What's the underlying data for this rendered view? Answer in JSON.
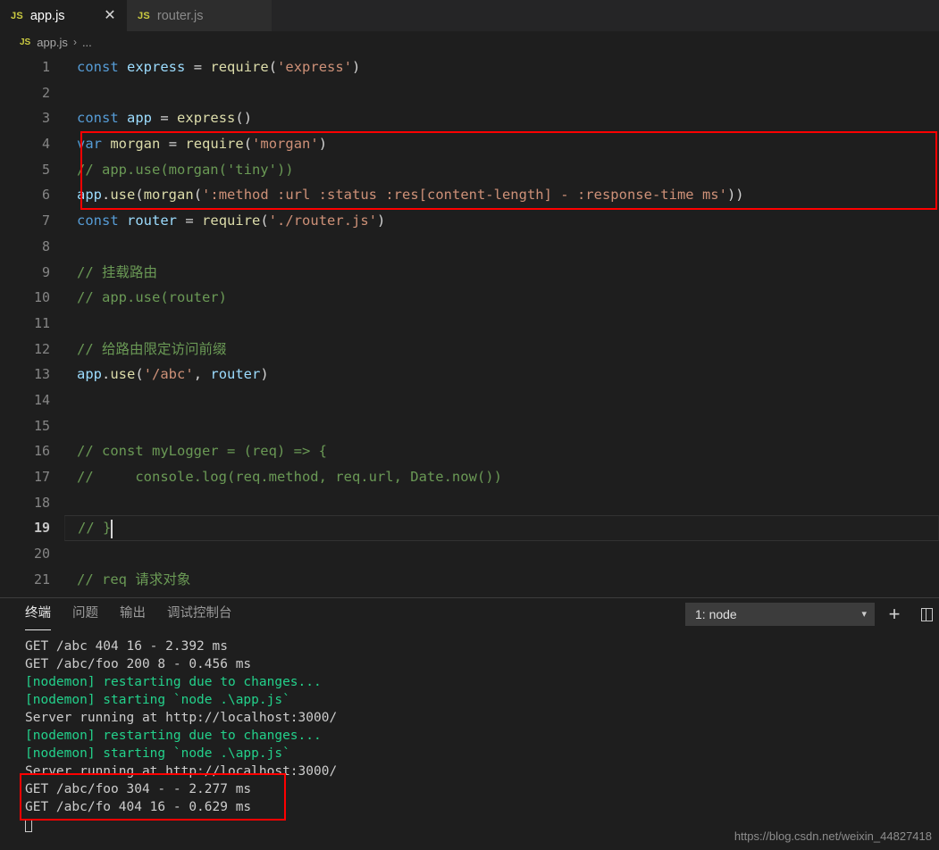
{
  "tabs": [
    {
      "label": "app.js",
      "badge": "JS",
      "active": true,
      "close_icon": "close-icon"
    },
    {
      "label": "router.js",
      "badge": "JS",
      "active": false
    }
  ],
  "breadcrumb": {
    "badge": "JS",
    "file": "app.js",
    "separator": "›",
    "more": "..."
  },
  "editor": {
    "lines": [
      {
        "n": "1",
        "tokens": [
          {
            "t": "const",
            "c": "kw"
          },
          {
            "t": " ",
            "c": "punc"
          },
          {
            "t": "express",
            "c": "ident"
          },
          {
            "t": " ",
            "c": "punc"
          },
          {
            "t": "=",
            "c": "op"
          },
          {
            "t": " ",
            "c": "punc"
          },
          {
            "t": "require",
            "c": "var"
          },
          {
            "t": "(",
            "c": "punc"
          },
          {
            "t": "'express'",
            "c": "str"
          },
          {
            "t": ")",
            "c": "punc"
          }
        ]
      },
      {
        "n": "2",
        "tokens": []
      },
      {
        "n": "3",
        "tokens": [
          {
            "t": "const",
            "c": "kw"
          },
          {
            "t": " ",
            "c": "punc"
          },
          {
            "t": "app",
            "c": "ident"
          },
          {
            "t": " ",
            "c": "punc"
          },
          {
            "t": "=",
            "c": "op"
          },
          {
            "t": " ",
            "c": "punc"
          },
          {
            "t": "express",
            "c": "var"
          },
          {
            "t": "()",
            "c": "punc"
          }
        ]
      },
      {
        "n": "4",
        "tokens": [
          {
            "t": "var",
            "c": "kw"
          },
          {
            "t": " ",
            "c": "punc"
          },
          {
            "t": "morgan",
            "c": "var"
          },
          {
            "t": " ",
            "c": "punc"
          },
          {
            "t": "=",
            "c": "op"
          },
          {
            "t": " ",
            "c": "punc"
          },
          {
            "t": "require",
            "c": "var"
          },
          {
            "t": "(",
            "c": "punc"
          },
          {
            "t": "'morgan'",
            "c": "str"
          },
          {
            "t": ")",
            "c": "punc"
          }
        ]
      },
      {
        "n": "5",
        "tokens": [
          {
            "t": "// app.use(morgan('tiny'))",
            "c": "cmt"
          }
        ]
      },
      {
        "n": "6",
        "tokens": [
          {
            "t": "app",
            "c": "ident"
          },
          {
            "t": ".",
            "c": "punc"
          },
          {
            "t": "use",
            "c": "var"
          },
          {
            "t": "(",
            "c": "punc"
          },
          {
            "t": "morgan",
            "c": "var"
          },
          {
            "t": "(",
            "c": "punc"
          },
          {
            "t": "':method :url :status :res[content-length] - :response-time ms'",
            "c": "str"
          },
          {
            "t": "))",
            "c": "punc"
          }
        ]
      },
      {
        "n": "7",
        "tokens": [
          {
            "t": "const",
            "c": "kw"
          },
          {
            "t": " ",
            "c": "punc"
          },
          {
            "t": "router",
            "c": "ident"
          },
          {
            "t": " ",
            "c": "punc"
          },
          {
            "t": "=",
            "c": "op"
          },
          {
            "t": " ",
            "c": "punc"
          },
          {
            "t": "require",
            "c": "var"
          },
          {
            "t": "(",
            "c": "punc"
          },
          {
            "t": "'./router.js'",
            "c": "str"
          },
          {
            "t": ")",
            "c": "punc"
          }
        ]
      },
      {
        "n": "8",
        "tokens": []
      },
      {
        "n": "9",
        "tokens": [
          {
            "t": "// 挂载路由",
            "c": "cmt"
          }
        ]
      },
      {
        "n": "10",
        "tokens": [
          {
            "t": "// app.use(router)",
            "c": "cmt"
          }
        ]
      },
      {
        "n": "11",
        "tokens": []
      },
      {
        "n": "12",
        "tokens": [
          {
            "t": "// 给路由限定访问前缀",
            "c": "cmt"
          }
        ]
      },
      {
        "n": "13",
        "tokens": [
          {
            "t": "app",
            "c": "ident"
          },
          {
            "t": ".",
            "c": "punc"
          },
          {
            "t": "use",
            "c": "var"
          },
          {
            "t": "(",
            "c": "punc"
          },
          {
            "t": "'/abc'",
            "c": "str"
          },
          {
            "t": ", ",
            "c": "punc"
          },
          {
            "t": "router",
            "c": "ident"
          },
          {
            "t": ")",
            "c": "punc"
          }
        ]
      },
      {
        "n": "14",
        "tokens": []
      },
      {
        "n": "15",
        "tokens": []
      },
      {
        "n": "16",
        "tokens": [
          {
            "t": "// const myLogger = (req) => {",
            "c": "cmt"
          }
        ]
      },
      {
        "n": "17",
        "tokens": [
          {
            "t": "//     console.log(req.method, req.url, Date.now())",
            "c": "cmt"
          }
        ]
      },
      {
        "n": "18",
        "tokens": []
      },
      {
        "n": "19",
        "tokens": [
          {
            "t": "// }",
            "c": "cmt"
          }
        ],
        "current": true,
        "cursor": true
      },
      {
        "n": "20",
        "tokens": []
      },
      {
        "n": "21",
        "tokens": [
          {
            "t": "// req 请求对象",
            "c": "cmt"
          }
        ]
      }
    ]
  },
  "panel": {
    "tabs": [
      {
        "label": "终端",
        "active": true
      },
      {
        "label": "问题",
        "active": false
      },
      {
        "label": "输出",
        "active": false
      },
      {
        "label": "调试控制台",
        "active": false
      }
    ],
    "terminal_select": {
      "value": "1: node",
      "chevron": "⌄"
    },
    "new_terminal_label": "+",
    "split_terminal_icon": "split-terminal-icon"
  },
  "terminal": {
    "lines": [
      {
        "text": "GET /abc 404 16 - 2.392 ms",
        "color": "white"
      },
      {
        "text": "GET /abc/foo 200 8 - 0.456 ms",
        "color": "white"
      },
      {
        "text": "[nodemon] restarting due to changes...",
        "color": "green"
      },
      {
        "text": "[nodemon] starting `node .\\app.js`",
        "color": "green"
      },
      {
        "text": "Server running at http://localhost:3000/",
        "color": "white"
      },
      {
        "text": "[nodemon] restarting due to changes...",
        "color": "green"
      },
      {
        "text": "[nodemon] starting `node .\\app.js`",
        "color": "green"
      },
      {
        "text": "Server running at http://localhost:3000/",
        "color": "white"
      },
      {
        "text": "GET /abc/foo 304 - - 2.277 ms",
        "color": "white"
      },
      {
        "text": "GET /abc/fo 404 16 - 0.629 ms",
        "color": "white"
      }
    ],
    "cursor": true
  },
  "watermark": "https://blog.csdn.net/weixin_44827418",
  "colors": {
    "editor_bg": "#1e1e1e",
    "tabbar_bg": "#252526",
    "inactive_tab_bg": "#2d2d2d",
    "annotation_red": "#ff0000",
    "terminal_green": "#23d18b",
    "keyword_blue": "#569cd6",
    "string_orange": "#ce9178",
    "comment_green": "#6a9955",
    "function_yellow": "#dcdcaa",
    "variable_blue": "#9cdcfe"
  }
}
